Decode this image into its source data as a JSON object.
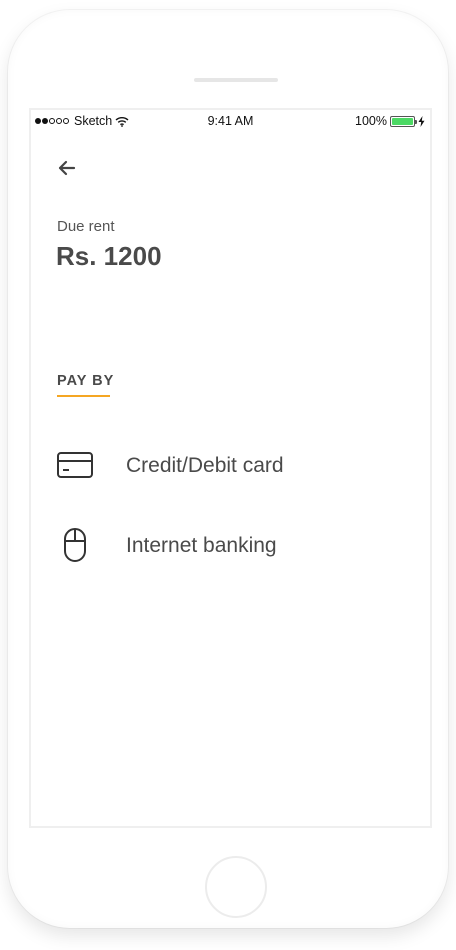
{
  "status_bar": {
    "carrier": "Sketch",
    "time": "9:41 AM",
    "battery": "100%"
  },
  "header": {
    "back_icon": "arrow-left-icon"
  },
  "due": {
    "label": "Due rent",
    "amount": "Rs. 1200"
  },
  "pay_by": {
    "heading": "PAY BY",
    "accent_color": "#f5a623",
    "options": [
      {
        "label": "Credit/Debit card",
        "icon": "credit-card-icon"
      },
      {
        "label": "Internet banking",
        "icon": "mouse-icon"
      }
    ]
  }
}
